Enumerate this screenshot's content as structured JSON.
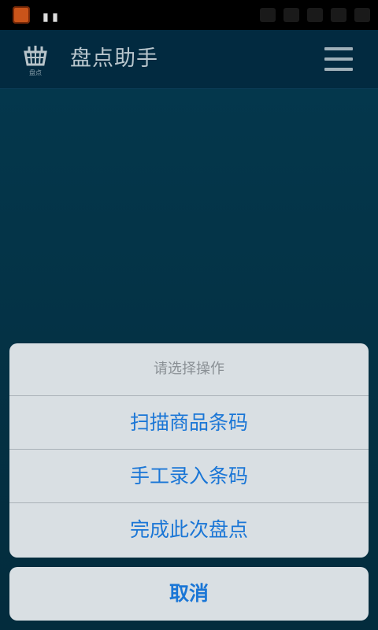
{
  "header": {
    "logo_caption": "盘点",
    "title": "盘点助手"
  },
  "status": {
    "indicators": "▮ ▮"
  },
  "action_sheet": {
    "title": "请选择操作",
    "options": [
      {
        "label": "扫描商品条码"
      },
      {
        "label": "手工录入条码"
      },
      {
        "label": "完成此次盘点"
      }
    ],
    "cancel_label": "取消"
  },
  "colors": {
    "background": "#04344a",
    "header": "#022a40",
    "sheet": "#d9dfe3",
    "accent": "#1a76d6"
  },
  "icons": {
    "menu": "hamburger-menu-icon",
    "logo": "basket-logo-icon"
  }
}
